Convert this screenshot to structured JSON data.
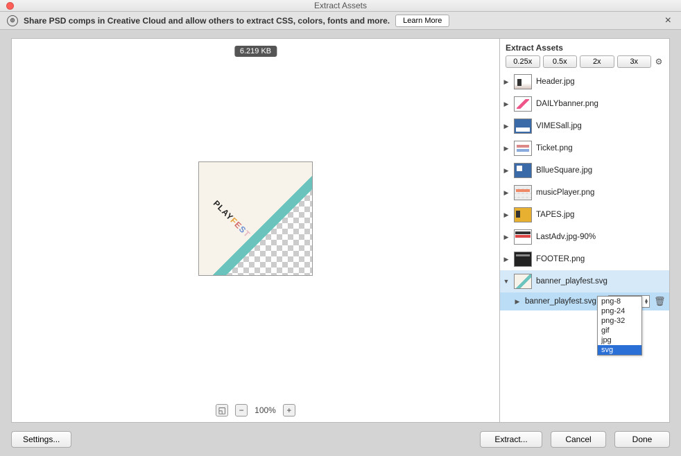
{
  "window": {
    "title": "Extract Assets"
  },
  "infobar": {
    "text": "Share PSD comps in Creative Cloud and allow others to extract CSS, colors, fonts and more.",
    "learn_more": "Learn More"
  },
  "preview": {
    "filesize": "6.219 KB",
    "zoom_level": "100%",
    "artwork_text": "PLAYFEST"
  },
  "panel": {
    "title": "Extract Assets",
    "scales": [
      "0.25x",
      "0.5x",
      "2x",
      "3x"
    ]
  },
  "assets": [
    {
      "name": "Header.jpg",
      "thumb": "th-header"
    },
    {
      "name": "DAILYbanner.png",
      "thumb": "th-daily"
    },
    {
      "name": "VIMESall.jpg",
      "thumb": "th-vimes"
    },
    {
      "name": "Ticket.png",
      "thumb": "th-ticket"
    },
    {
      "name": "BllueSquare.jpg",
      "thumb": "th-blue"
    },
    {
      "name": "musicPlayer.png",
      "thumb": "th-music"
    },
    {
      "name": "TAPES.jpg",
      "thumb": "th-tapes"
    },
    {
      "name": "LastAdv.jpg-90%",
      "thumb": "th-last"
    },
    {
      "name": "FOOTER.png",
      "thumb": "th-footer"
    },
    {
      "name": "banner_playfest.svg",
      "thumb": "th-banner",
      "selected": true,
      "expanded": true
    }
  ],
  "sub_asset": {
    "name": "banner_playfest.svg",
    "format": "svg"
  },
  "format_options": [
    "png-8",
    "png-24",
    "png-32",
    "gif",
    "jpg",
    "svg"
  ],
  "format_selected_index": 5,
  "buttons": {
    "settings": "Settings...",
    "extract": "Extract...",
    "cancel": "Cancel",
    "done": "Done"
  }
}
